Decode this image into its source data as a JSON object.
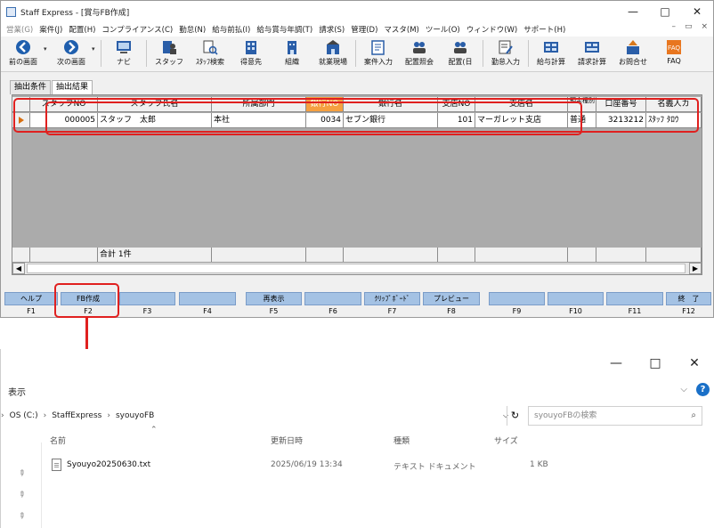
{
  "window": {
    "title": "Staff Express - [賞与FB作成]",
    "controls": [
      "—",
      "□",
      "✕"
    ]
  },
  "menubar": {
    "items": [
      "営業(G)",
      "案件(J)",
      "配置(H)",
      "コンプライアンス(C)",
      "勤怠(N)",
      "給与前払(I)",
      "給与賞与年調(T)",
      "請求(S)",
      "管理(D)",
      "マスタ(M)",
      "ツール(O)",
      "ウィンドウ(W)",
      "サポート(H)"
    ],
    "mdi_controls": [
      "–",
      "▭",
      "×"
    ]
  },
  "toolbar": {
    "items": [
      {
        "label": "前の画面",
        "icon": "back-arrow-icon"
      },
      {
        "label": "次の画面",
        "icon": "forward-arrow-icon"
      },
      {
        "label": "ナビ",
        "icon": "navi-icon"
      },
      {
        "label": "スタッフ",
        "icon": "staff-icon"
      },
      {
        "label": "ｽﾀｯﾌ検索",
        "icon": "staff-search-icon"
      },
      {
        "label": "得意先",
        "icon": "client-icon"
      },
      {
        "label": "組織",
        "icon": "organization-icon"
      },
      {
        "label": "就業現場",
        "icon": "worksite-icon"
      },
      {
        "label": "案件入力",
        "icon": "job-entry-icon"
      },
      {
        "label": "配置照会",
        "icon": "assignment-inquiry-icon"
      },
      {
        "label": "配置(日",
        "icon": "assignment-daily-icon"
      },
      {
        "label": "勤怠入力",
        "icon": "attendance-entry-icon"
      },
      {
        "label": "給与計算",
        "icon": "payroll-icon"
      },
      {
        "label": "請求計算",
        "icon": "billing-icon"
      },
      {
        "label": "お問合せ",
        "icon": "inquiry-icon"
      },
      {
        "label": "FAQ",
        "icon": "faq-icon"
      }
    ]
  },
  "tabs": [
    "抽出条件",
    "抽出結果"
  ],
  "grid": {
    "columns": [
      "スタッフNO",
      "スタッフ氏名",
      "所属部門",
      "銀行NO",
      "銀行名",
      "支店NO",
      "支店名",
      "預金種別",
      "口座番号",
      "名義人カ"
    ],
    "rows": [
      [
        "000005",
        "スタッフ　太郎",
        "本社",
        "0034",
        "セブン銀行",
        "101",
        "マーガレット支店",
        "普通",
        "3213212",
        "ｽﾀｯﾌ ﾀﾛｳ"
      ]
    ],
    "footer_total": "合計 1件"
  },
  "fkeys": [
    {
      "label": "ヘルプ",
      "key": "F1"
    },
    {
      "label": "FB作成",
      "key": "F2"
    },
    {
      "label": "",
      "key": "F3"
    },
    {
      "label": "",
      "key": "F4"
    },
    {
      "label": "再表示",
      "key": "F5"
    },
    {
      "label": "",
      "key": "F6"
    },
    {
      "label": "ｸﾘｯﾌﾟﾎﾞｰﾄﾞ",
      "key": "F7"
    },
    {
      "label": "プレビュー",
      "key": "F8"
    },
    {
      "label": "",
      "key": "F9"
    },
    {
      "label": "",
      "key": "F10"
    },
    {
      "label": "",
      "key": "F11"
    },
    {
      "label": "終　了",
      "key": "F12"
    }
  ],
  "explorer": {
    "ribbon": "表示",
    "path": [
      "OS (C:)",
      "StaffExpress",
      "syouyoFB"
    ],
    "search_placeholder": "syouyoFBの検索",
    "columns": [
      "名前",
      "更新日時",
      "種類",
      "サイズ"
    ],
    "file": {
      "name": "Syouyo20250630.txt",
      "modified": "2025/06/19 13:34",
      "type": "テキスト ドキュメント",
      "size": "1 KB"
    }
  },
  "colors": {
    "highlight": "#e0201f",
    "fkey": "#a4c2e4",
    "orange_header": "#f5a040"
  }
}
